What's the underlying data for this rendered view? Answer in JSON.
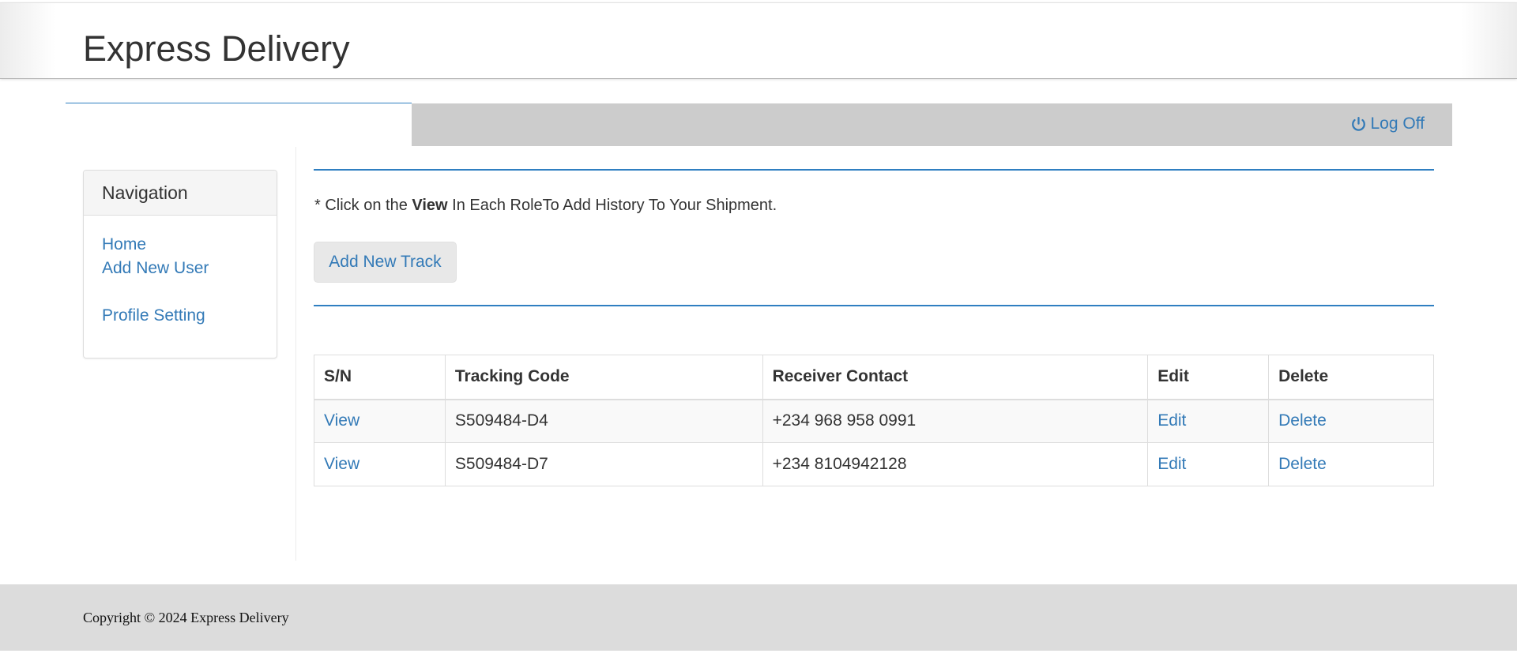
{
  "header": {
    "brand": "Express Delivery"
  },
  "topbar": {
    "logoff_label": "Log Off",
    "logoff_icon": "power-icon"
  },
  "sidebar": {
    "title": "Navigation",
    "items": [
      {
        "label": "Home"
      },
      {
        "label": "Add New User"
      },
      {
        "label": "Profile Setting"
      }
    ]
  },
  "main": {
    "instruction": {
      "prefix": "* Click on the ",
      "bold": "View",
      "suffix": " In Each RoleTo Add History To Your Shipment."
    },
    "add_track_label": "Add New Track",
    "table": {
      "headers": [
        "S/N",
        "Tracking Code",
        "Receiver Contact",
        "Edit",
        "Delete"
      ],
      "rows": [
        {
          "sn": "View",
          "code": "S509484-D4",
          "contact": "+234 968 958 0991",
          "edit": "Edit",
          "delete": "Delete"
        },
        {
          "sn": "View",
          "code": "S509484-D7",
          "contact": "+234 8104942128",
          "edit": "Edit",
          "delete": "Delete"
        }
      ]
    }
  },
  "footer": {
    "copyright": "Copyright © 2024 Express Delivery"
  },
  "colors": {
    "link": "#337ab7",
    "accent_rule": "#2f7fc1",
    "topbar_gray": "#cccccc",
    "footer_gray": "#dcdcdc"
  }
}
